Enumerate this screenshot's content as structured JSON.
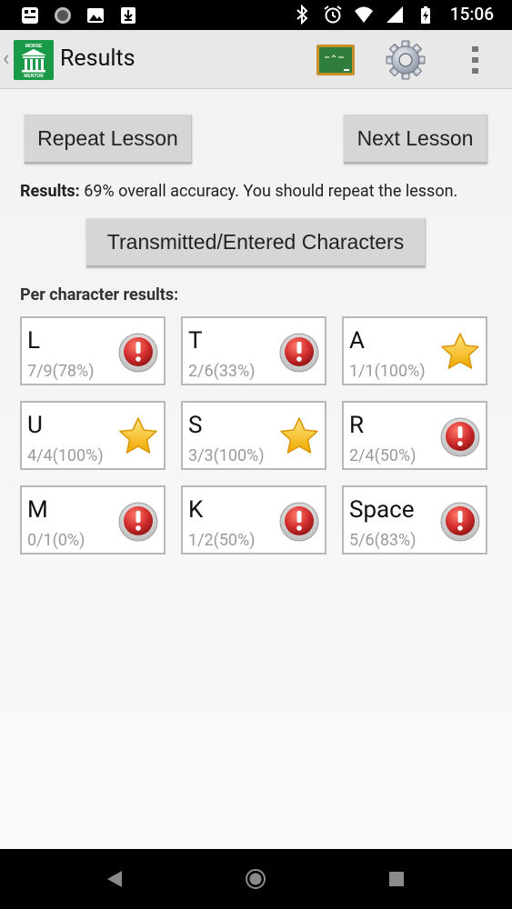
{
  "status_bar": {
    "time": "15:06",
    "left_icons": [
      "app-notification-icon",
      "circle-notification-icon",
      "image-notification-icon",
      "download-notification-icon"
    ],
    "right_icons": [
      "bluetooth-icon",
      "alarm-icon",
      "wifi-icon",
      "signal-icon",
      "battery-icon"
    ]
  },
  "action_bar": {
    "title": "Results",
    "logo_text": [
      "MORSE",
      "MENTOR"
    ],
    "actions": [
      "chalkboard-icon",
      "settings-gear-icon",
      "overflow-menu-icon"
    ]
  },
  "buttons": {
    "repeat": "Repeat Lesson",
    "next": "Next Lesson",
    "transmitted": "Transmitted/Entered Characters"
  },
  "results": {
    "label": "Results:",
    "text": "69% overall accuracy. You should repeat the lesson."
  },
  "per_character_label": "Per character results:",
  "characters": [
    {
      "char": "L",
      "stat": "7/9(78%)",
      "status": "warning"
    },
    {
      "char": "T",
      "stat": "2/6(33%)",
      "status": "warning"
    },
    {
      "char": "A",
      "stat": "1/1(100%)",
      "status": "star"
    },
    {
      "char": "U",
      "stat": "4/4(100%)",
      "status": "star"
    },
    {
      "char": "S",
      "stat": "3/3(100%)",
      "status": "star"
    },
    {
      "char": "R",
      "stat": "2/4(50%)",
      "status": "warning"
    },
    {
      "char": "M",
      "stat": "0/1(0%)",
      "status": "warning"
    },
    {
      "char": "K",
      "stat": "1/2(50%)",
      "status": "warning"
    },
    {
      "char": "Space",
      "stat": "5/6(83%)",
      "status": "warning"
    }
  ],
  "colors": {
    "warning_red": "#d32f2f",
    "star_gold": "#f5b800",
    "logo_green": "#199a48",
    "button_gray": "#d6d6d6"
  }
}
